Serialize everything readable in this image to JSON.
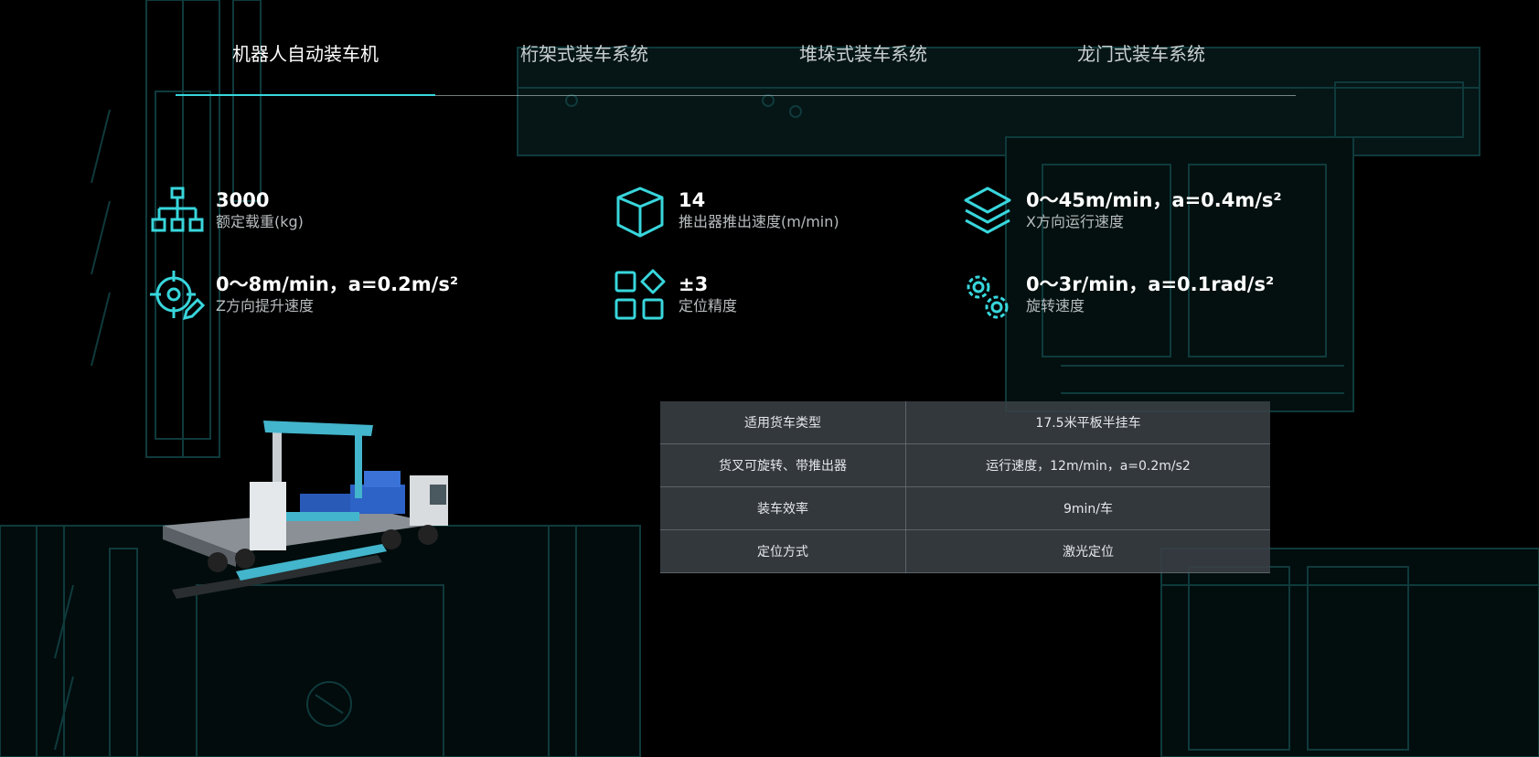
{
  "tabs": [
    {
      "label": "机器人自动装车机",
      "active": true
    },
    {
      "label": "桁架式装车系统",
      "active": false
    },
    {
      "label": "堆垛式装车系统",
      "active": false
    },
    {
      "label": "龙门式装车系统",
      "active": false
    }
  ],
  "stats": [
    {
      "value": "3000",
      "label": "额定载重(kg)",
      "icon": "sitemap-icon"
    },
    {
      "value": "14",
      "label": "推出器推出速度(m/min)",
      "icon": "cube-icon"
    },
    {
      "value": "0～45m/min，a=0.4m/s²",
      "label": "X方向运行速度",
      "icon": "layers-icon"
    },
    {
      "value": "0～8m/min，a=0.2m/s²",
      "label": "Z方向提升速度",
      "icon": "target-pencil-icon"
    },
    {
      "value": "±3",
      "label": "定位精度",
      "icon": "grid-diamond-icon"
    },
    {
      "value": "0～3r/min，a=0.1rad/s²",
      "label": "旋转速度",
      "icon": "gears-icon"
    }
  ],
  "specs": [
    {
      "key": "适用货车类型",
      "value": "17.5米平板半挂车"
    },
    {
      "key": "货叉可旋转、带推出器",
      "value": "运行速度，12m/min，a=0.2m/s2"
    },
    {
      "key": "装车效率",
      "value": "9min/车"
    },
    {
      "key": "定位方式",
      "value": "激光定位"
    }
  ],
  "colors": {
    "accent": "#38d6dc",
    "background": "#000000",
    "table_bg": "#3a4046",
    "schematic": "#0f3a3c"
  }
}
